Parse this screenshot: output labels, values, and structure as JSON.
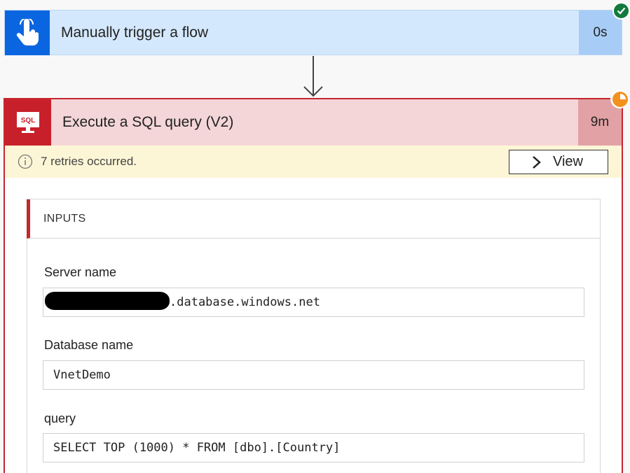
{
  "trigger": {
    "title": "Manually trigger a flow",
    "duration": "0s",
    "icon": "touch-hand-icon",
    "status": "success",
    "accent": "#0a66e0"
  },
  "action": {
    "title": "Execute a SQL query (V2)",
    "duration": "9m",
    "icon": "sql-monitor-icon",
    "icon_text": "SQL",
    "status": "running",
    "accent": "#c6262e"
  },
  "warning": {
    "text": "7 retries occurred.",
    "view_label": "View"
  },
  "inputs": {
    "title": "INPUTS",
    "fields": [
      {
        "label": "Server name",
        "value": ".database.windows.net",
        "redacted_prefix": true
      },
      {
        "label": "Database name",
        "value": "VnetDemo"
      },
      {
        "label": "query",
        "value": "SELECT TOP (1000) * FROM [dbo].[Country]"
      }
    ]
  }
}
